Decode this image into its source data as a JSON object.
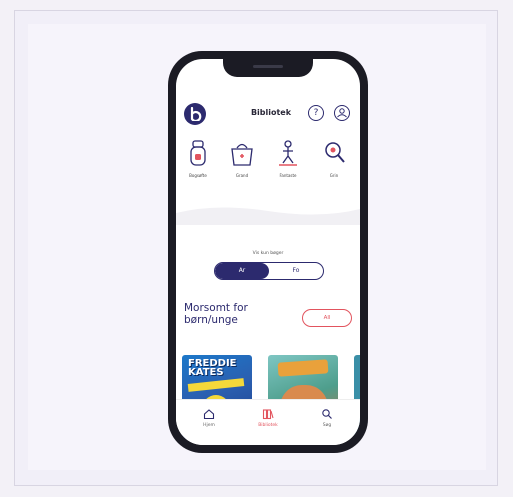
{
  "header": {
    "title": "Bibliotek",
    "help_glyph": "?",
    "account_icon": "account-icon"
  },
  "categories": [
    {
      "label": "Bogsøfte",
      "icon": "bottle-icon"
    },
    {
      "label": "Grand",
      "icon": "bag-icon"
    },
    {
      "label": "Fantaste",
      "icon": "figure-icon"
    },
    {
      "label": "Grin",
      "icon": "magnify-icon"
    }
  ],
  "toggle": {
    "label": "Vis kun bøger",
    "on_label": "Ar",
    "off_label": "Fo"
  },
  "section": {
    "title": "Morsomt for børn/unge",
    "all_label": "All"
  },
  "books": [
    {
      "title": "FREDDIE KATES"
    }
  ],
  "tabbar": {
    "items": [
      {
        "label": "Hjem",
        "icon": "home-icon"
      },
      {
        "label": "Bibliotek",
        "icon": "library-icon"
      },
      {
        "label": "Søg",
        "icon": "search-icon"
      }
    ]
  },
  "colors": {
    "primary": "#2c2a6e",
    "accent": "#e2545e"
  }
}
